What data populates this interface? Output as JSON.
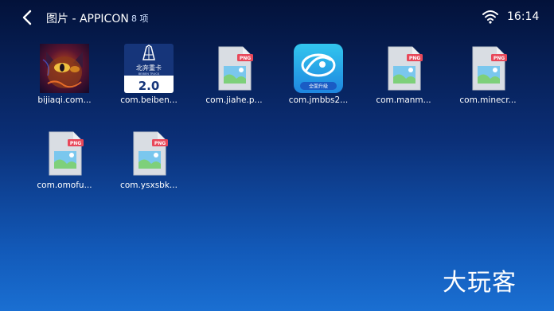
{
  "header": {
    "title": "图片 - APPICON",
    "count": "8 项",
    "time": "16:14"
  },
  "files": [
    {
      "label": "bijiaqi.com...",
      "icon": "cat-photo-thumbnail"
    },
    {
      "label": "com.beiben...",
      "icon": "beiben-truck-app-thumbnail"
    },
    {
      "label": "com.jiahe.p...",
      "icon": "png-file-icon"
    },
    {
      "label": "com.jmbbs2...",
      "icon": "jmbbs-app-thumbnail"
    },
    {
      "label": "com.manm...",
      "icon": "png-file-icon"
    },
    {
      "label": "com.minecr...",
      "icon": "png-file-icon"
    },
    {
      "label": "com.omofu...",
      "icon": "png-file-icon"
    },
    {
      "label": "com.ysxsbk...",
      "icon": "png-file-icon"
    }
  ],
  "thumbnails": {
    "beiben": {
      "name": "北奔重卡",
      "sub": "BEIBEN TRUCK",
      "version": "2.0"
    },
    "jmbbs": {
      "caption": "全面升级"
    }
  },
  "png_badge": "PNG",
  "brand": "大玩客",
  "colors": {
    "accent": "#1a6fd2",
    "png_badge": "#e8485a",
    "file_body": "#d9dde3"
  }
}
